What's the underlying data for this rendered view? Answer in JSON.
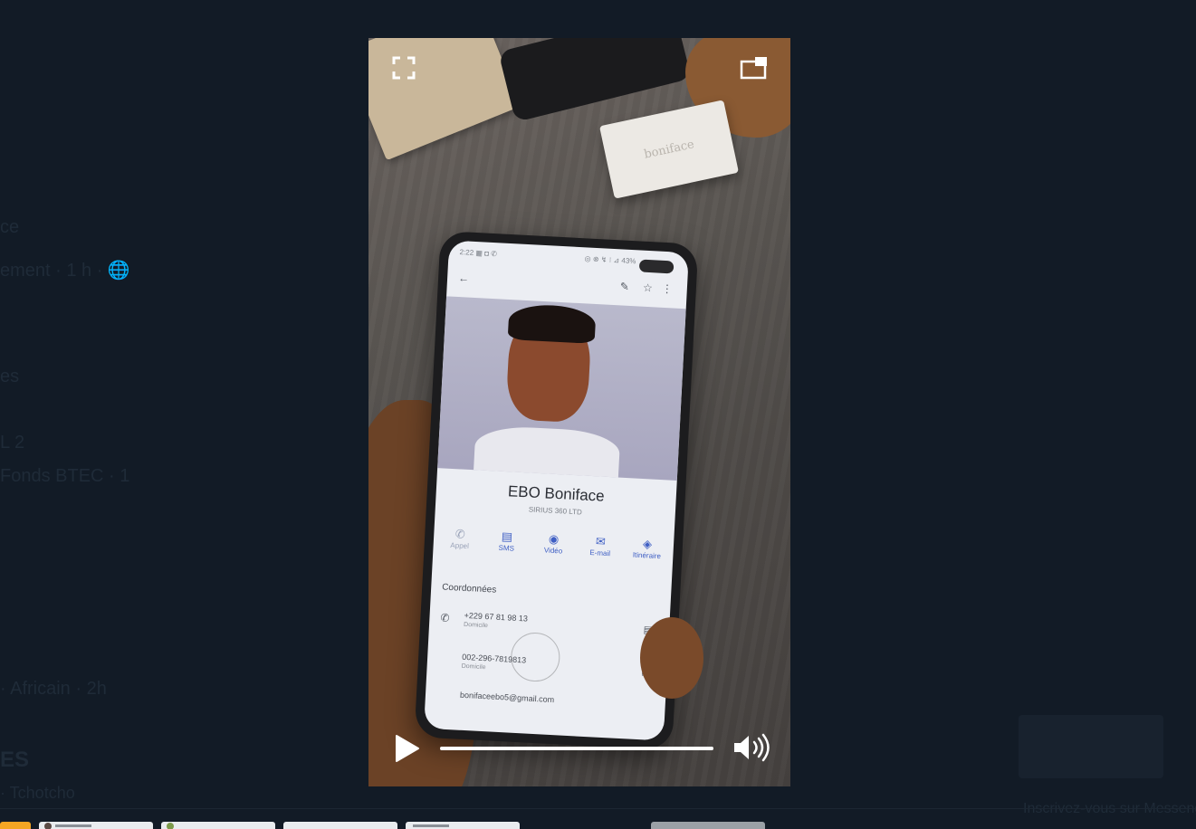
{
  "background": {
    "left_lines": [
      "ce",
      "ement · 1 h · 🌐",
      "es",
      "L  2",
      "Fonds BTEC  · 1",
      "· Africain  ·   2h",
      "ES",
      "· Tchotcho"
    ],
    "right_line": "Inscrivez-vous sur Messenger"
  },
  "video": {
    "card_text": "boniface",
    "phone": {
      "status_left": "2:22 ▦ ◘ ✆",
      "status_right": "◎ ⊗ ↯ ⁝ ⊿ 43%",
      "back_icon": "←",
      "edit_icon": "✎",
      "star_icon": "☆",
      "more_icon": "⋮",
      "contact_name": "EBO Boniface",
      "company": "SIRIUS 360 LTD",
      "actions": [
        {
          "label": "Appel",
          "icon": "✆"
        },
        {
          "label": "SMS",
          "icon": "▤"
        },
        {
          "label": "Vidéo",
          "icon": "◉"
        },
        {
          "label": "E-mail",
          "icon": "✉"
        },
        {
          "label": "Itinéraire",
          "icon": "◈"
        }
      ],
      "section_title": "Coordonnées",
      "rows": [
        {
          "value": "+229 67 81 98 13",
          "sub": "Domicile"
        },
        {
          "value": "002-296-7819813",
          "sub": "Domicile"
        },
        {
          "value": "bonifaceebo5@gmail.com",
          "sub": ""
        }
      ]
    },
    "progress_fraction": 1.0,
    "colors": {
      "control": "#ffffff",
      "progress_track": "rgba(255,255,255,0.45)"
    },
    "icons": {
      "fullscreen": "fullscreen-icon",
      "pip": "picture-in-picture-icon",
      "play": "play-icon",
      "volume": "volume-icon"
    }
  }
}
